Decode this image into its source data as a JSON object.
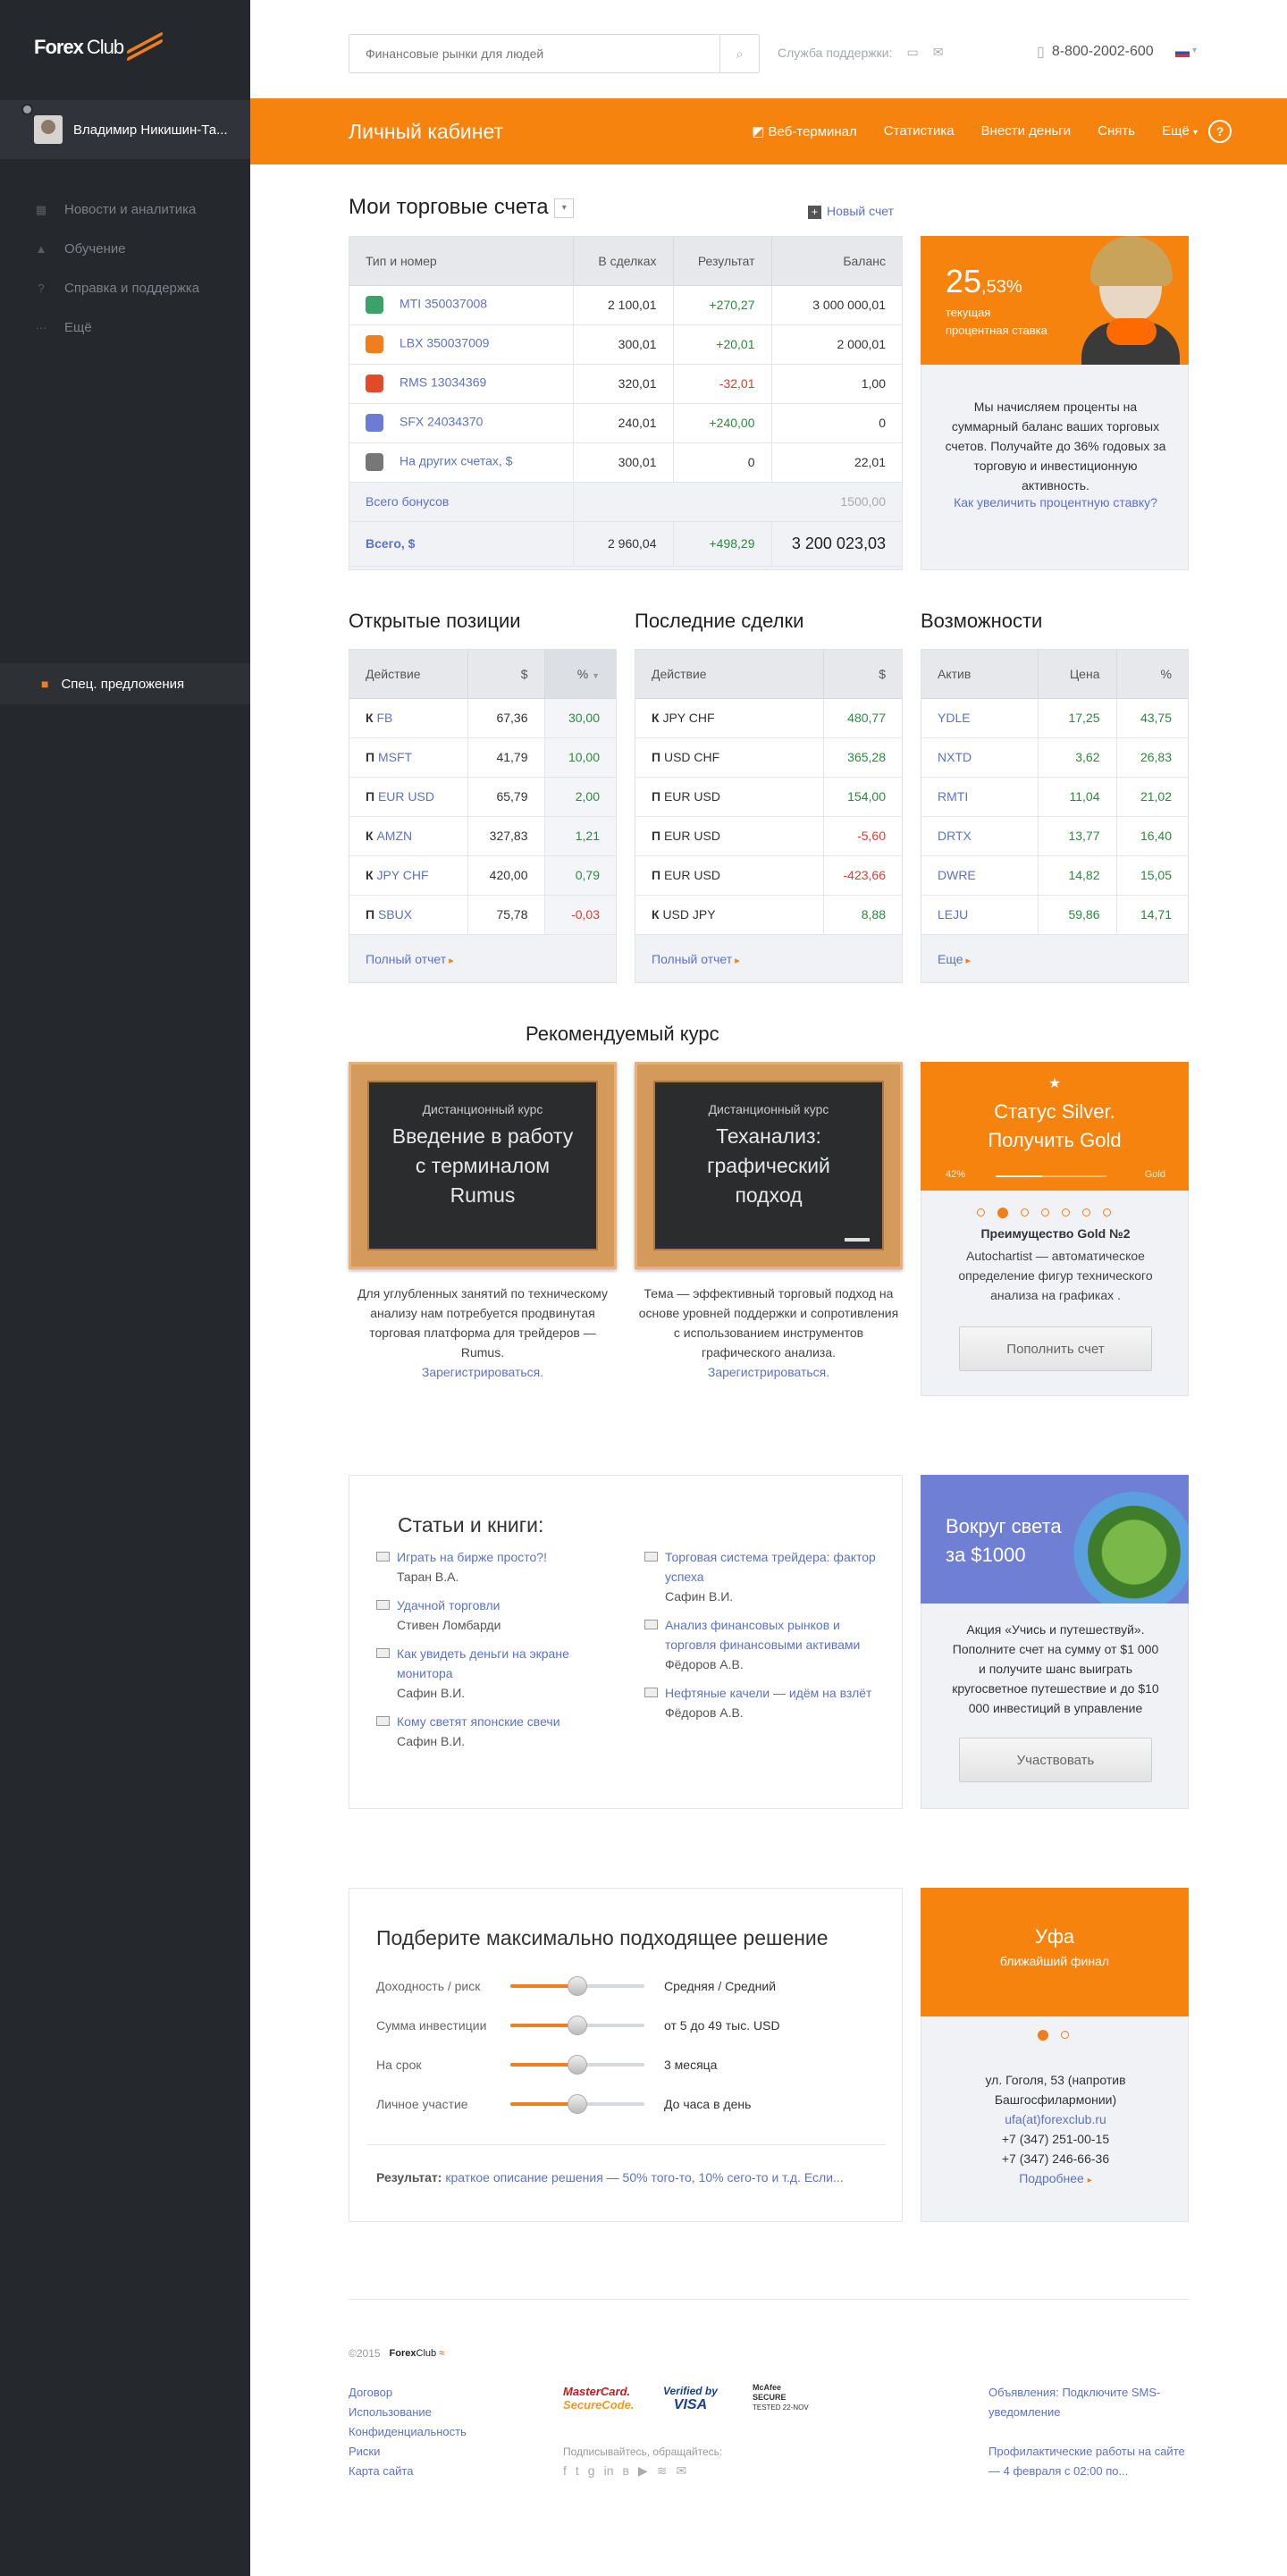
{
  "sidebar": {
    "brand_left": "Forex",
    "brand_right": "Club",
    "user_name": "Владимир Никишин-Та...",
    "nav": [
      "Новости и аналитика",
      "Обучение",
      "Справка и поддержка",
      "Ещё"
    ],
    "promo": "Спец. предложения"
  },
  "header": {
    "search_placeholder": "Финансовые рынки для людей",
    "support": "Служба поддержки:",
    "phone": "8-800-2002-600"
  },
  "orangebar": {
    "title": "Личный кабинет",
    "menu": [
      "Веб-терминал",
      "Статистика",
      "Внести деньги",
      "Снять",
      "Ещё"
    ],
    "help": "?"
  },
  "accounts": {
    "title": "Мои торговые счета",
    "new_account": "Новый счет",
    "columns": [
      "Тип и номер",
      "В сделках",
      "Результат",
      "Баланс"
    ],
    "rows": [
      {
        "name": "MTI 350037008",
        "deals": "2 100,01",
        "result": "+270,27",
        "balance": "3 000 000,01",
        "sign": "pos",
        "color": "#3aa36a"
      },
      {
        "name": "LBX 350037009",
        "deals": "300,01",
        "result": "+20,01",
        "balance": "2 000,01",
        "sign": "pos",
        "color": "#f07e1c"
      },
      {
        "name": "RMS 13034369",
        "deals": "320,01",
        "result": "-32,01",
        "balance": "1,00",
        "sign": "neg",
        "color": "#e24a2a"
      },
      {
        "name": "SFX 24034370",
        "deals": "240,01",
        "result": "+240,00",
        "balance": "0",
        "sign": "pos",
        "color": "#6b7bd6"
      },
      {
        "name": "На других счетах, $",
        "deals": "300,01",
        "result": "0",
        "balance": "22,01",
        "sign": "",
        "color": "#777"
      }
    ],
    "bonus_label": "Всего бонусов",
    "bonus_value": "1500,00",
    "total_label": "Всего, $",
    "total_deals": "2 960,04",
    "total_result": "+498,29",
    "total_balance": "3 200 023,03"
  },
  "rate": {
    "value": "25",
    "fraction": ",53%",
    "caption_1": "текущая",
    "caption_2": "процентная ставка",
    "text": "Мы начисляем проценты на суммарный баланс ваших торговых счетов. Получайте до 36% годовых за торговую и инвестиционную активность.",
    "link": "Как увеличить процентную ставку?"
  },
  "positions": {
    "title": "Открытые позиции",
    "columns": [
      "Действие",
      "$",
      "%"
    ],
    "rows": [
      {
        "k": "К",
        "sym": "FB",
        "usd": "67,36",
        "pct": "30,00",
        "sign": "pos"
      },
      {
        "k": "П",
        "sym": "MSFT",
        "usd": "41,79",
        "pct": "10,00",
        "sign": "pos"
      },
      {
        "k": "П",
        "sym": "EUR USD",
        "usd": "65,79",
        "pct": "2,00",
        "sign": "pos"
      },
      {
        "k": "К",
        "sym": "AMZN",
        "usd": "327,83",
        "pct": "1,21",
        "sign": "pos"
      },
      {
        "k": "К",
        "sym": "JPY CHF",
        "usd": "420,00",
        "pct": "0,79",
        "sign": "pos"
      },
      {
        "k": "П",
        "sym": "SBUX",
        "usd": "75,78",
        "pct": "-0,03",
        "sign": "neg"
      }
    ],
    "more": "Полный отчет"
  },
  "deals": {
    "title": "Последние сделки",
    "columns": [
      "Действие",
      "$"
    ],
    "rows": [
      {
        "k": "К",
        "sym": "JPY CHF",
        "usd": "480,77",
        "sign": "pos"
      },
      {
        "k": "П",
        "sym": "USD CHF",
        "usd": "365,28",
        "sign": "pos"
      },
      {
        "k": "П",
        "sym": "EUR USD",
        "usd": "154,00",
        "sign": "pos"
      },
      {
        "k": "П",
        "sym": "EUR USD",
        "usd": "-5,60",
        "sign": "neg"
      },
      {
        "k": "П",
        "sym": "EUR USD",
        "usd": "-423,66",
        "sign": "neg"
      },
      {
        "k": "К",
        "sym": "USD  JPY",
        "usd": "8,88",
        "sign": "pos"
      }
    ],
    "more": "Полный отчет"
  },
  "opportunities": {
    "title": "Возможности",
    "columns": [
      "Актив",
      "Цена",
      "%"
    ],
    "rows": [
      {
        "sym": "YDLE",
        "price": "17,25",
        "pct": "43,75"
      },
      {
        "sym": "NXTD",
        "price": "3,62",
        "pct": "26,83"
      },
      {
        "sym": "RMTI",
        "price": "11,04",
        "pct": "21,02"
      },
      {
        "sym": "DRTX",
        "price": "13,77",
        "pct": "16,40"
      },
      {
        "sym": "DWRE",
        "price": "14,82",
        "pct": "15,05"
      },
      {
        "sym": "LEJU",
        "price": "59,86",
        "pct": "14,71"
      }
    ],
    "more": "Еще"
  },
  "courses": {
    "title": "Рекомендуемый курс",
    "items": [
      {
        "small": "Дистанционный курс",
        "big": "Введение в работу с терминалом Rumus",
        "desc": "Для углубленных занятий по техническому анализу нам потребуется продвинутая торговая платформа для трейдеров — Rumus.",
        "link": "Зарегистрироваться."
      },
      {
        "small": "Дистанционный курс",
        "big": "Теханализ: графический подход",
        "desc": "Тема — эффективный торговый подход на основе уровней поддержки и сопротивления с использованием инструментов графического анализа.",
        "link": "Зарегистрироваться."
      }
    ]
  },
  "status": {
    "star": "★",
    "title": "Статус Silver. Получить Gold",
    "progress_label": "42%",
    "progress": 0.42,
    "gold_label": "Gold",
    "adv_title": "Преимущество Gold №2",
    "adv_text": "Autochartist —  автоматическое определение фигур технического анализа на графиках .",
    "button": "Пополнить счет"
  },
  "books": {
    "title": "Статьи и книги:",
    "items": [
      {
        "t": "Играть на бирже просто?!",
        "a": "Таран В.А."
      },
      {
        "t": "Удачной торговли",
        "a": "Стивен Ломбарди"
      },
      {
        "t": "Как увидеть деньги на экране монитора",
        "a": "Сафин В.И."
      },
      {
        "t": "Кому светят японские свечи",
        "a": "Сафин В.И."
      },
      {
        "t": "Торговая система трейдера: фактор успеха",
        "a": "Сафин В.И."
      },
      {
        "t": "Анализ финансовых рынков и торговля финансовыми активами",
        "a": "Фёдоров А.В."
      },
      {
        "t": "Нефтяные качели — идём на взлёт",
        "a": "Фёдоров А.В."
      }
    ]
  },
  "travel": {
    "title": "Вокруг света за $1000",
    "text": "Акция «Учись и путешествуй». Пополните счет на сумму от $1 000 и получите шанс выиграть кругосветное путешествие и до $10 000 инвестиций в управление",
    "button": "Участвовать"
  },
  "solver": {
    "title": "Подберите максимально подходящее решение",
    "rows": [
      {
        "label": "Доходность / риск",
        "value": "Средняя / Средний",
        "level": 0.5
      },
      {
        "label": "Сумма инвестиции",
        "value": "от 5 до 49 тыс. USD",
        "level": 0.5
      },
      {
        "label": "На срок",
        "value": "3 месяца",
        "level": 0.5
      },
      {
        "label": "Личное участие",
        "value": "До часа в день",
        "level": 0.5
      }
    ],
    "result_label": "Результат:",
    "result_text": "краткое описание решения —  50% того-то, 10% сего-то и т.д. Если..."
  },
  "final": {
    "city": "Уфа",
    "sub": "ближайший финал",
    "address": "ул. Гоголя, 53 (напротив Башгосфилармонии)",
    "email": "ufa(at)forexclub.ru",
    "phone1": "+7 (347) 251-00-15",
    "phone2": "+7 (347) 246-66-36",
    "more": "Подробнее"
  },
  "footer": {
    "copyright": "©2015",
    "links": [
      "Договор",
      "Использование",
      "Конфиденциальность",
      "Риски",
      "Карта сайта"
    ],
    "mastercard_1": "MasterCard.",
    "mastercard_2": "SecureCode.",
    "visa_1": "Verified by",
    "visa_2": "VISA",
    "mcafee_1": "McAfee",
    "mcafee_2": "SECURE",
    "mcafee_3": "TESTED 22-NOV",
    "subscribe": "Подписывайтесь, обращайтесь:",
    "ann_label": "Объявления:",
    "ann_text": "Подключите SMS-уведомление",
    "maint": "Профилактические работы на сайте — 4 февраля с 02:00 по..."
  }
}
